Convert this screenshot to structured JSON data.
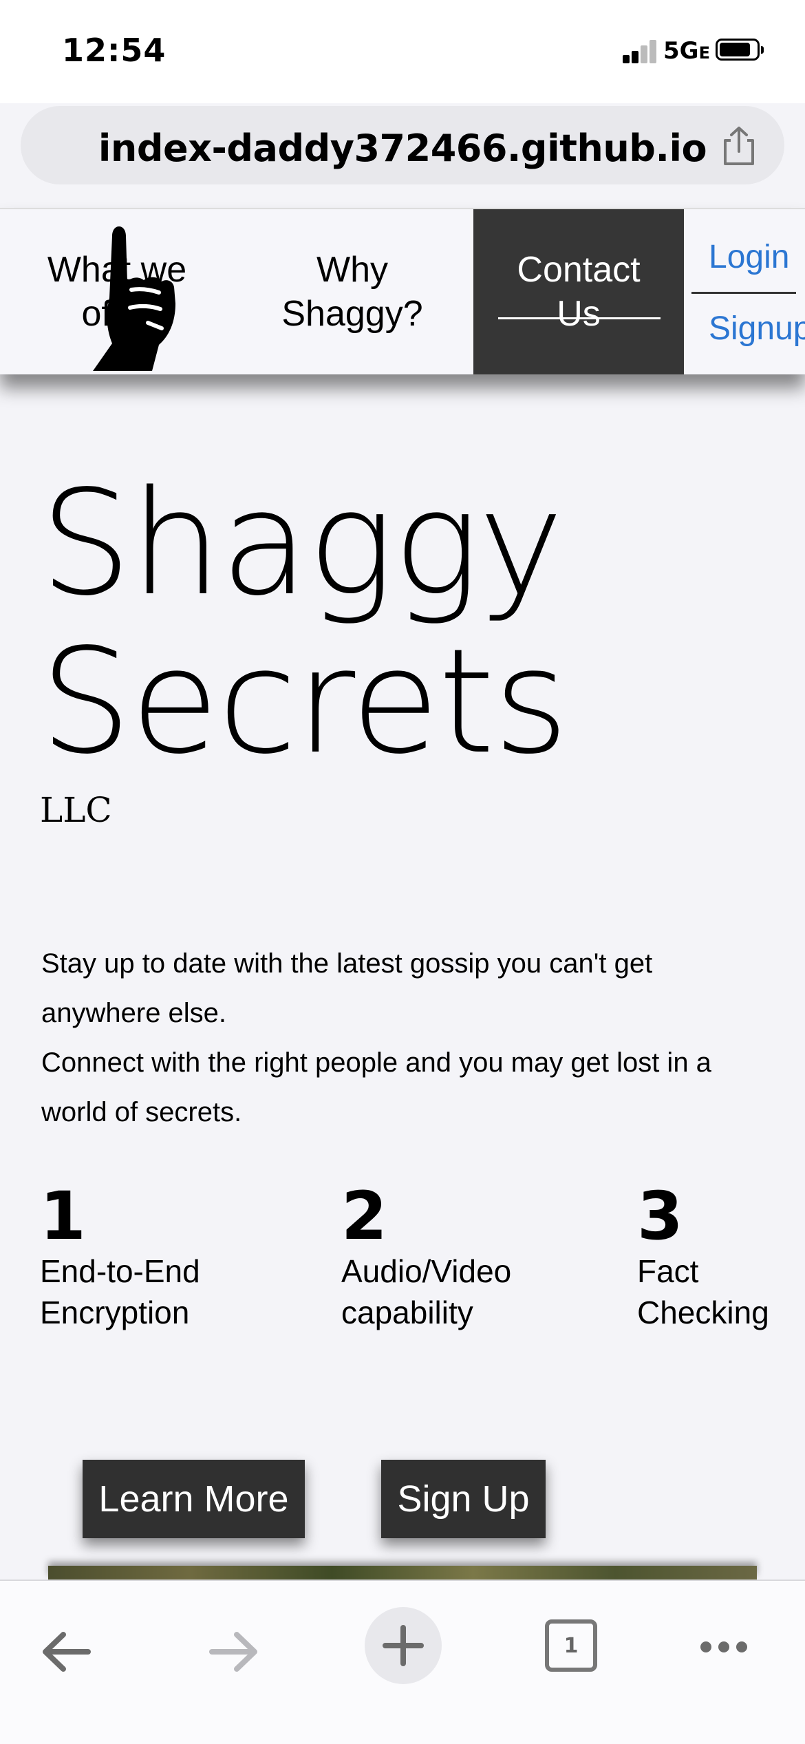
{
  "status": {
    "time": "12:54",
    "network": "5G",
    "network_suffix": "E"
  },
  "browser": {
    "url": "index-daddy372466.github.io",
    "tab_count": "1"
  },
  "nav": {
    "offer_label": "What we offer",
    "why_label": "Why Shaggy?",
    "contact_label": "Contact Us",
    "login_label": "Login",
    "signup_label": "Signup"
  },
  "hero": {
    "title": "Shaggy Secrets",
    "subtitle": "LLC",
    "description": [
      "Stay up to date with the latest gossip you can't get anywhere else.",
      "Connect with the right people and you may get lost in a world of secrets."
    ]
  },
  "features": [
    {
      "number": "1",
      "label": "End-to-End Encryption"
    },
    {
      "number": "2",
      "label": "Audio/Video capability"
    },
    {
      "number": "3",
      "label": "Fact Checking"
    }
  ],
  "cta": {
    "learn_more": "Learn More",
    "sign_up": "Sign Up"
  }
}
